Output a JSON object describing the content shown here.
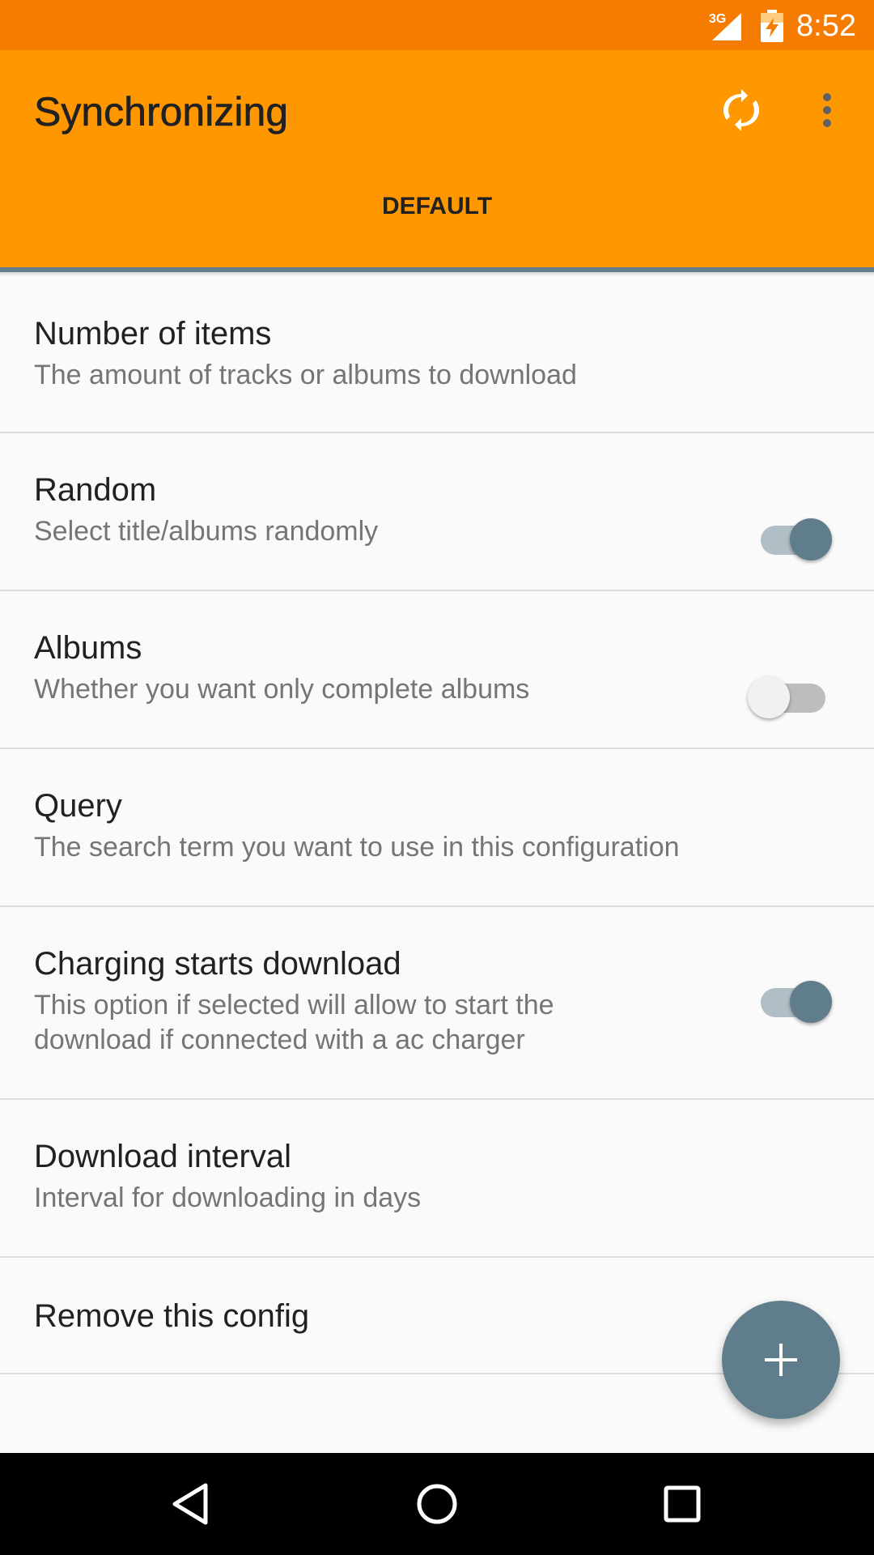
{
  "status_bar": {
    "network": "3G",
    "time": "8:52",
    "icons": [
      "signal-icon",
      "battery-charging-icon"
    ]
  },
  "app_bar": {
    "title": "Synchronizing",
    "actions": [
      "sync-icon",
      "more-vert-icon"
    ],
    "tabs": [
      {
        "label": "DEFAULT",
        "selected": true
      }
    ]
  },
  "preferences": [
    {
      "title": "Number of items",
      "summary": "The amount of tracks or albums to download"
    },
    {
      "title": "Random",
      "summary": "Select title/albums randomly",
      "toggle": true
    },
    {
      "title": "Albums",
      "summary": "Whether you want only complete albums",
      "toggle": false
    },
    {
      "title": "Query",
      "summary": "The search term you want to use in this configuration"
    },
    {
      "title": "Charging starts download",
      "summary_line1": "This option if selected will allow to start the",
      "summary_line2": "download if connected with a ac charger",
      "toggle": true
    },
    {
      "title": "Download interval",
      "summary": "Interval for downloading in days"
    },
    {
      "title": "Remove this config"
    }
  ],
  "fab": {
    "icon": "add-icon"
  },
  "nav_bar": {
    "buttons": [
      "back-icon",
      "home-icon",
      "recents-icon"
    ]
  },
  "colors": {
    "status_bar": "#f57c00",
    "app_bar": "#ff9800",
    "accent": "#607d8b"
  }
}
